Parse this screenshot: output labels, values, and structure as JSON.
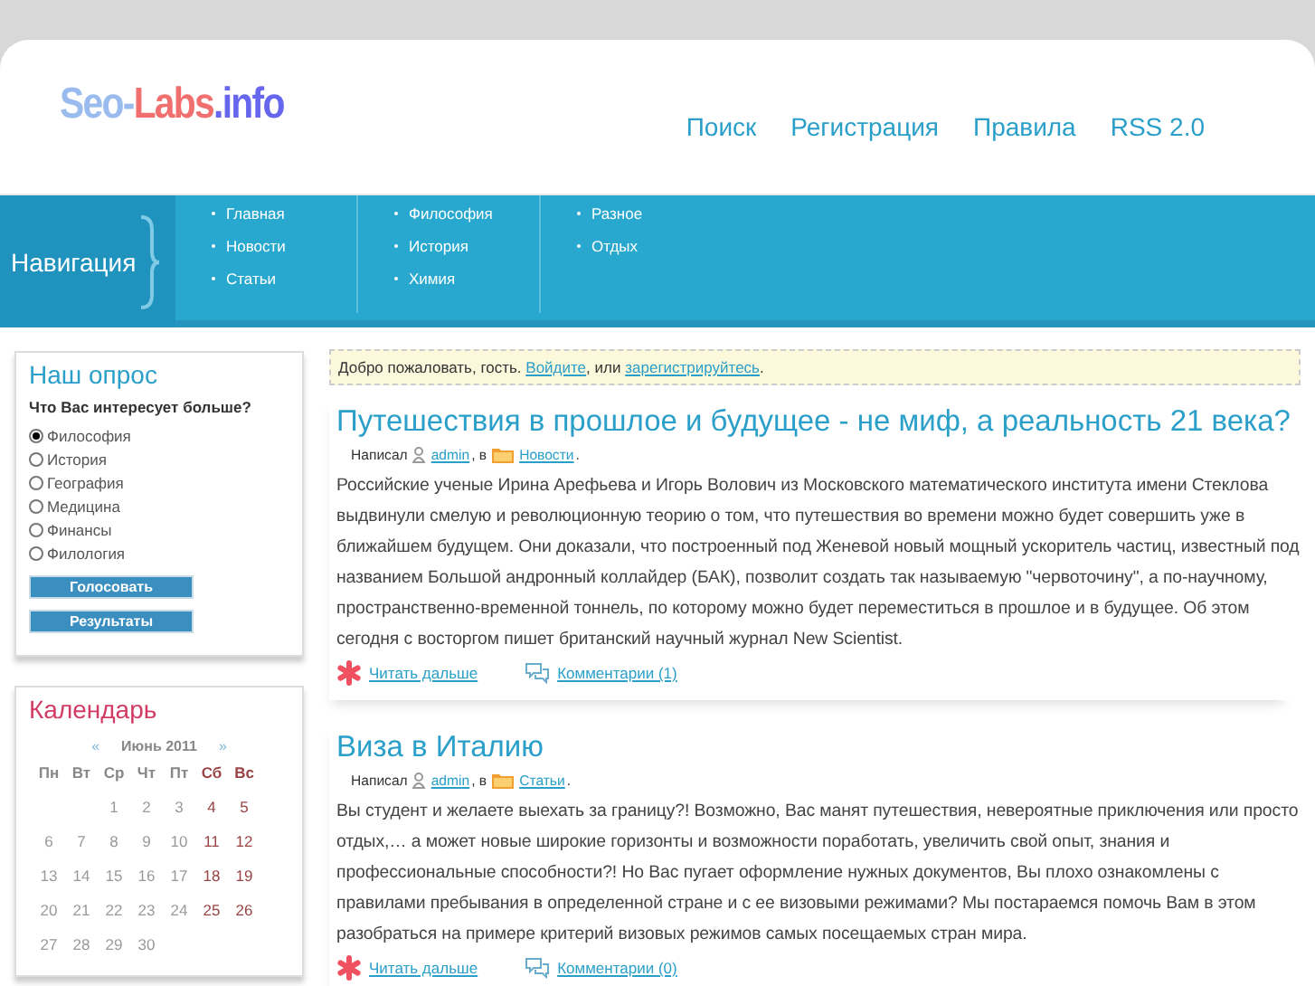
{
  "logo": [
    {
      "text": "Seo-",
      "color": "#99bbee"
    },
    {
      "text": "Labs",
      "color": "#f07070"
    },
    {
      "text": ".info",
      "color": "#6666ee"
    }
  ],
  "top_links": [
    "Поиск",
    "Регистрация",
    "Правила",
    "RSS 2.0"
  ],
  "navigation": {
    "title": "Навигация",
    "columns": [
      [
        "Главная",
        "Новости",
        "Статьи"
      ],
      [
        "Философия",
        "История",
        "Химия"
      ],
      [
        "Разное",
        "Отдых"
      ]
    ]
  },
  "poll": {
    "title": "Наш опрос",
    "question": "Что Вас интересует больше?",
    "options": [
      {
        "label": "Философия",
        "selected": true
      },
      {
        "label": "История",
        "selected": false
      },
      {
        "label": "География",
        "selected": false
      },
      {
        "label": "Медицина",
        "selected": false
      },
      {
        "label": "Финансы",
        "selected": false
      },
      {
        "label": "Филология",
        "selected": false
      }
    ],
    "buttons": [
      "Голосовать",
      "Результаты"
    ]
  },
  "calendar": {
    "title": "Календарь",
    "prev": "«",
    "month": "Июнь 2011",
    "next": "»",
    "weekdays": [
      {
        "label": "Пн",
        "weekend": false
      },
      {
        "label": "Вт",
        "weekend": false
      },
      {
        "label": "Ср",
        "weekend": false
      },
      {
        "label": "Чт",
        "weekend": false
      },
      {
        "label": "Пт",
        "weekend": false
      },
      {
        "label": "Сб",
        "weekend": true
      },
      {
        "label": "Вс",
        "weekend": true
      }
    ],
    "weeks": [
      [
        {
          "day": "1",
          "weekend": false
        },
        {
          "day": "2",
          "weekend": false
        },
        {
          "day": "3",
          "weekend": false
        },
        {
          "day": "4",
          "weekend": true
        },
        {
          "day": "5",
          "weekend": true
        }
      ],
      [
        {
          "day": "6",
          "weekend": false
        },
        {
          "day": "7",
          "weekend": false
        },
        {
          "day": "8",
          "weekend": false
        },
        {
          "day": "9",
          "weekend": false
        },
        {
          "day": "10",
          "weekend": false
        },
        {
          "day": "11",
          "weekend": true
        },
        {
          "day": "12",
          "weekend": true
        }
      ],
      [
        {
          "day": "13",
          "weekend": false
        },
        {
          "day": "14",
          "weekend": false
        },
        {
          "day": "15",
          "weekend": false
        },
        {
          "day": "16",
          "weekend": false
        },
        {
          "day": "17",
          "weekend": false
        },
        {
          "day": "18",
          "weekend": true
        },
        {
          "day": "19",
          "weekend": true
        }
      ],
      [
        {
          "day": "20",
          "weekend": false
        },
        {
          "day": "21",
          "weekend": false
        },
        {
          "day": "22",
          "weekend": false
        },
        {
          "day": "23",
          "weekend": false
        },
        {
          "day": "24",
          "weekend": false
        },
        {
          "day": "25",
          "weekend": true
        },
        {
          "day": "26",
          "weekend": true
        }
      ],
      [
        {
          "day": "27",
          "weekend": false
        },
        {
          "day": "28",
          "weekend": false
        },
        {
          "day": "29",
          "weekend": false
        },
        {
          "day": "30",
          "weekend": false
        }
      ]
    ]
  },
  "welcome": {
    "text": "Добро пожаловать, гость.",
    "login_link": "Войдите",
    "middle": ", или",
    "register_link": "зарегистрируйтесь",
    "end": "."
  },
  "posts": [
    {
      "title": "Путешествия в прошлое и будущее - не миф, а реальность 21 века?",
      "by": "Написал",
      "author": "admin",
      "in": ", в",
      "category": "Новости",
      "end": ".",
      "body": "Российские ученые Ирина Арефьева и Игорь Волович из Московского математического института имени Стеклова выдвинули смелую и революционную теорию о том, что путешествия во времени можно будет совершить уже в ближайшем будущем. Они доказали, что построенный под Женевой новый мощный ускоритель частиц, известный под названием Большой андронный коллайдер (БАК), позволит создать так называемую \"червоточину\", а по-научному, пространственно-временной тоннель, по которому можно будет переместиться в прошлое и в будущее. Об этом сегодня с восторгом пишет британский научный журнал New Scientist.",
      "read_more": "Читать дальше",
      "comments": "Комментарии (1)"
    },
    {
      "title": "Виза в Италию",
      "by": "Написал",
      "author": "admin",
      "in": ", в",
      "category": "Статьи",
      "end": ".",
      "body": "Вы студент и желаете выехать за границу?! Возможно, Вас манят путешествия, невероятные приключения или просто отдых,… а может новые широкие горизонты и возможности поработать, увеличить свой опыт, знания и профессиональные способности?! Но Вас пугает оформление нужных документов, Вы плохо ознакомлены с правилами пребывания в определенной стране и с ее визовыми режимами? Мы постараемся помочь Вам в этом разобраться на примере критерий визовых режимов самых посещаемых стран мира.",
      "read_more": "Читать дальше",
      "comments": "Комментарии (0)"
    }
  ]
}
